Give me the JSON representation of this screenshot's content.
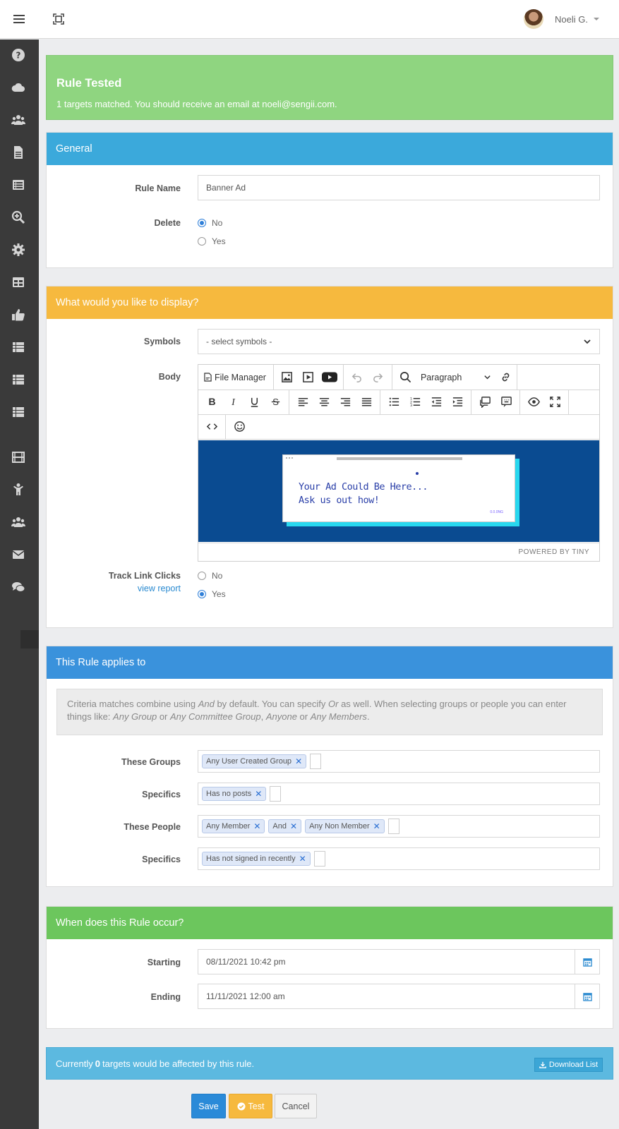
{
  "topbar": {
    "user_name": "Noeli G."
  },
  "sidebar": {
    "items": [
      "question-icon",
      "cloud-icon",
      "users-icon",
      "document-icon",
      "list-icon",
      "search-plus-icon",
      "gear-icon",
      "table-icon",
      "thumbs-up-icon",
      "list-icon",
      "list-icon",
      "list-icon",
      "film-icon",
      "child-icon",
      "group-icon",
      "envelope-icon",
      "comments-icon"
    ]
  },
  "alert": {
    "title": "Rule Tested",
    "message": "1 targets matched. You should receive an email at noeli@sengii.com.",
    "bg": "#8fd580"
  },
  "general": {
    "heading": "General",
    "color": "#3ba9db",
    "rule_name_label": "Rule Name",
    "rule_name_value": "Banner Ad",
    "delete_label": "Delete",
    "delete_options": [
      {
        "label": "No",
        "checked": true
      },
      {
        "label": "Yes",
        "checked": false
      }
    ]
  },
  "display": {
    "heading": "What would you like to display?",
    "color": "#f6b93e",
    "symbols_label": "Symbols",
    "symbols_value": "- select symbols -",
    "body_label": "Body",
    "file_manager": "File Manager",
    "paragraph": "Paragraph",
    "ad_line1": "Your Ad Could Be Here...",
    "ad_line2": "Ask us out how!",
    "ad_small": "0.0.0NG",
    "powered_by": "POWERED BY TINY",
    "track_label": "Track Link Clicks",
    "view_report": "view report",
    "track_options": [
      {
        "label": "No",
        "checked": false
      },
      {
        "label": "Yes",
        "checked": true
      }
    ]
  },
  "applies": {
    "heading": "This Rule applies to",
    "color": "#3a92dc",
    "info": {
      "p1": "Criteria matches combine using ",
      "and": "And",
      "p2": " by default. You can specify ",
      "or": "Or",
      "p3": " as well. When selecting groups or people you can enter things like: ",
      "any_group": "Any Group",
      "p4": " or ",
      "any_committee": "Any Committee Group",
      "p5": ", ",
      "anyone": "Anyone",
      "p6": " or ",
      "any_members": "Any Members",
      "p7": "."
    },
    "groups_label": "These Groups",
    "groups_tags": [
      "Any User Created Group"
    ],
    "specifics1_label": "Specifics",
    "specifics1_tags": [
      "Has no posts"
    ],
    "people_label": "These People",
    "people_tags": [
      "Any Member",
      "And",
      "Any Non Member"
    ],
    "specifics2_label": "Specifics",
    "specifics2_tags": [
      "Has not signed in recently"
    ]
  },
  "occur": {
    "heading": "When does this Rule occur?",
    "color": "#6cc65d",
    "starting_label": "Starting",
    "starting_value": "08/11/2021 10:42 pm",
    "ending_label": "Ending",
    "ending_value": "11/11/2021 12:00 am"
  },
  "affected": {
    "prefix": "Currently ",
    "count": "0",
    "suffix": " targets would be affected by this rule.",
    "download": "Download List"
  },
  "actions": {
    "save": "Save",
    "test": "Test",
    "cancel": "Cancel"
  }
}
